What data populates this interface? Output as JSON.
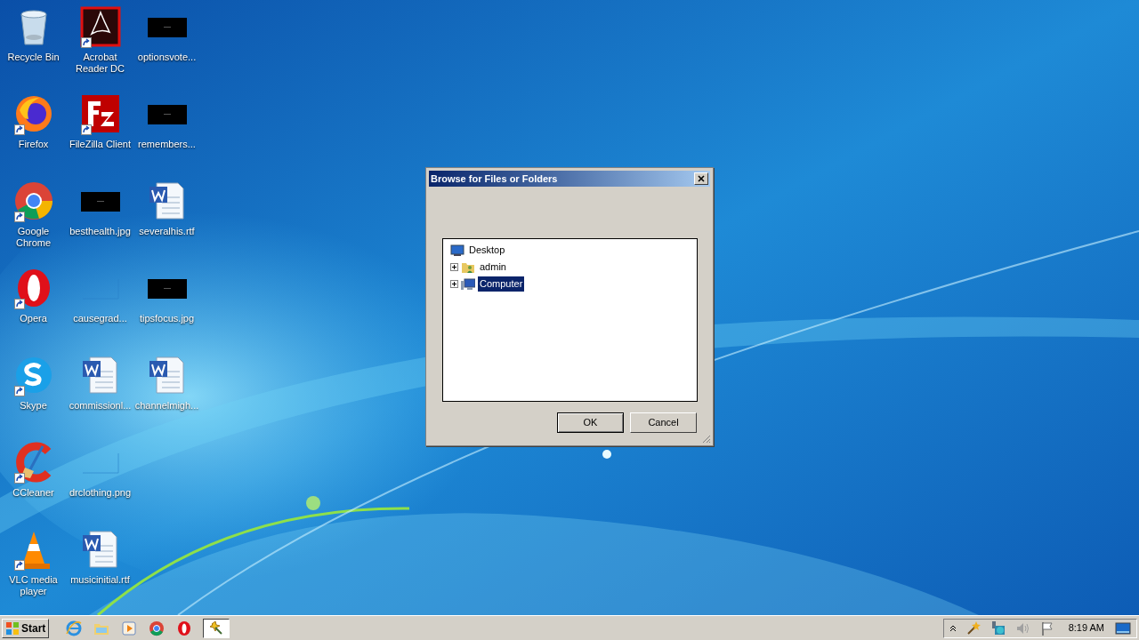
{
  "desktop_icons": [
    {
      "label": "Recycle Bin",
      "kind": "recycle",
      "shortcut": false
    },
    {
      "label": "Firefox",
      "kind": "firefox",
      "shortcut": true
    },
    {
      "label": "Google Chrome",
      "kind": "chrome",
      "shortcut": true
    },
    {
      "label": "Opera",
      "kind": "opera",
      "shortcut": true
    },
    {
      "label": "Skype",
      "kind": "skype",
      "shortcut": true
    },
    {
      "label": "CCleaner",
      "kind": "ccleaner",
      "shortcut": true
    },
    {
      "label": "VLC media player",
      "kind": "vlc",
      "shortcut": true
    },
    {
      "label": "Acrobat Reader DC",
      "kind": "acrobat",
      "shortcut": true
    },
    {
      "label": "FileZilla Client",
      "kind": "filezilla",
      "shortcut": true
    },
    {
      "label": "besthealth.jpg",
      "kind": "dark",
      "shortcut": false
    },
    {
      "label": "causegrad...",
      "kind": "blank",
      "shortcut": false
    },
    {
      "label": "commissionl...",
      "kind": "word",
      "shortcut": false
    },
    {
      "label": "drclothing.png",
      "kind": "blank",
      "shortcut": false
    },
    {
      "label": "musicinitial.rtf",
      "kind": "word",
      "shortcut": false
    },
    {
      "label": "optionsvote...",
      "kind": "dark",
      "shortcut": false
    },
    {
      "label": "remembers...",
      "kind": "dark",
      "shortcut": false
    },
    {
      "label": "severalhis.rtf",
      "kind": "word",
      "shortcut": false
    },
    {
      "label": "tipsfocus.jpg",
      "kind": "dark",
      "shortcut": false
    },
    {
      "label": "channelmigh...",
      "kind": "word",
      "shortcut": false
    }
  ],
  "dialog": {
    "title": "Browse for Files or Folders",
    "tree": {
      "label": "Desktop",
      "kind": "desktop",
      "selected": false,
      "children": [
        {
          "label": "admin",
          "kind": "user",
          "expanded": false,
          "selected": false
        },
        {
          "label": "Computer",
          "kind": "computer",
          "expanded": false,
          "selected": true
        }
      ]
    },
    "buttons": [
      "OK",
      "Cancel"
    ]
  },
  "taskbar": {
    "start": "Start",
    "apps": [
      {
        "kind": "ie",
        "active": false
      },
      {
        "kind": "folder",
        "active": false
      },
      {
        "kind": "media",
        "active": false
      },
      {
        "kind": "chrome",
        "active": false
      },
      {
        "kind": "opera",
        "active": false
      },
      {
        "kind": "wand",
        "active": true
      }
    ],
    "tray": {
      "clock": "8:19 AM"
    }
  }
}
